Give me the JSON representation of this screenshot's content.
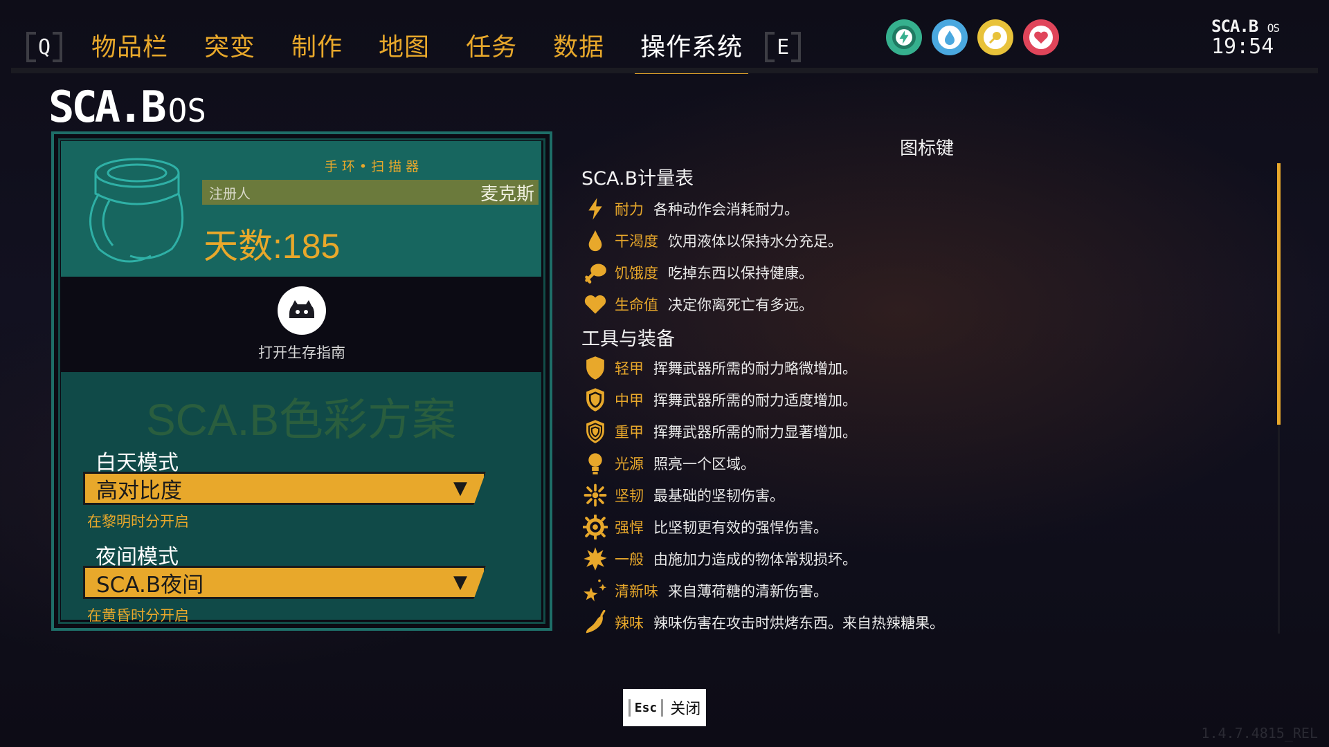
{
  "nav": {
    "left_key": "Q",
    "right_key": "E",
    "tabs": [
      "物品栏",
      "突变",
      "制作",
      "地图",
      "任务",
      "数据",
      "操作系统"
    ],
    "active_tab": "操作系统"
  },
  "status_icons": [
    {
      "name": "stamina",
      "icon": "lightning-icon",
      "color": "#36b08e"
    },
    {
      "name": "thirst",
      "icon": "water-drop-icon",
      "color": "#4aa8df"
    },
    {
      "name": "hunger",
      "icon": "food-icon",
      "color": "#e8c23a"
    },
    {
      "name": "health",
      "icon": "heart-icon",
      "color": "#e0455a"
    }
  ],
  "clock": {
    "logo": "SCA.B",
    "logo_suffix": "OS",
    "time": "19:54"
  },
  "os_logo": {
    "main": "SCA.B",
    "suffix": "OS"
  },
  "scanner": {
    "title": "手环•扫描器",
    "owner_label": "注册人",
    "owner_name": "麦克斯",
    "days": "天数:185"
  },
  "guide": {
    "label": "打开生存指南"
  },
  "color_scheme": {
    "title": "SCA.B色彩方案",
    "day": {
      "label": "白天模式",
      "value": "高对比度",
      "note": "在黎明时分开启"
    },
    "night": {
      "label": "夜间模式",
      "value": "SCA.B夜间",
      "note": "在黄昏时分开启"
    }
  },
  "icon_key": {
    "title": "图标键",
    "sections": [
      {
        "title": "SCA.B计量表",
        "items": [
          {
            "icon": "lightning-icon",
            "name": "耐力",
            "desc": "各种动作会消耗耐力。"
          },
          {
            "icon": "water-drop-icon",
            "name": "干渴度",
            "desc": "饮用液体以保持水分充足。"
          },
          {
            "icon": "drumstick-icon",
            "name": "饥饿度",
            "desc": "吃掉东西以保持健康。"
          },
          {
            "icon": "heart-icon",
            "name": "生命值",
            "desc": "决定你离死亡有多远。"
          }
        ]
      },
      {
        "title": "工具与装备",
        "items": [
          {
            "icon": "shield-light-icon",
            "name": "轻甲",
            "desc": "挥舞武器所需的耐力略微增加。"
          },
          {
            "icon": "shield-medium-icon",
            "name": "中甲",
            "desc": "挥舞武器所需的耐力适度增加。"
          },
          {
            "icon": "shield-heavy-icon",
            "name": "重甲",
            "desc": "挥舞武器所需的耐力显著增加。"
          },
          {
            "icon": "bulb-icon",
            "name": "光源",
            "desc": "照亮一个区域。"
          },
          {
            "icon": "sparkle-icon",
            "name": "坚韧",
            "desc": "最基础的坚韧伤害。"
          },
          {
            "icon": "gear-burst-icon",
            "name": "强悍",
            "desc": "比坚韧更有效的强悍伤害。"
          },
          {
            "icon": "starburst-icon",
            "name": "一般",
            "desc": "由施加力造成的物体常规损坏。"
          },
          {
            "icon": "mint-stars-icon",
            "name": "清新味",
            "desc": "来自薄荷糖的清新伤害。"
          },
          {
            "icon": "pepper-icon",
            "name": "辣味",
            "desc": "辣味伤害在攻击时烘烤东西。来自热辣糖果。"
          }
        ]
      }
    ]
  },
  "footer": {
    "close_key": "Esc",
    "close_label": "关闭",
    "version": "1.4.7.4815_REL"
  },
  "colors": {
    "accent": "#e8a82b",
    "panel_teal": "#17665f",
    "scheme_teal": "#104a48"
  }
}
